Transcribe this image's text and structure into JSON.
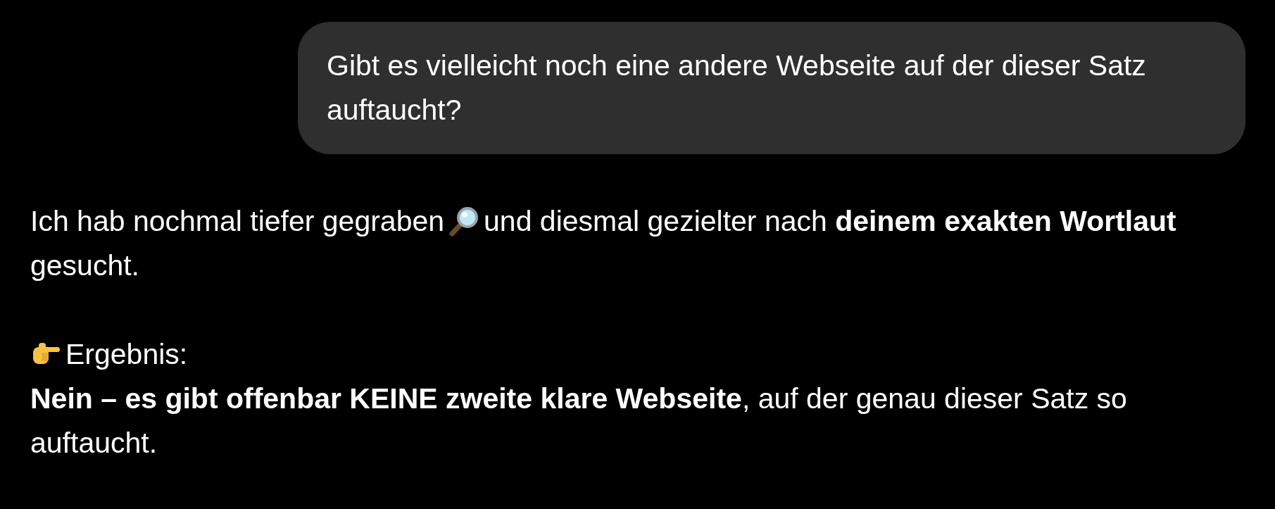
{
  "user_message": {
    "text": "Gibt es vielleicht noch eine andere Webseite auf der dieser Satz auftaucht?"
  },
  "assistant_message": {
    "paragraphs": [
      {
        "kind": "search",
        "before": "Ich hab nochmal tiefer gegraben",
        "after": "und diesmal gezielter nach **deinem exakten Wortlaut**",
        "lines": [
          "gesucht."
        ]
      },
      {
        "kind": "result",
        "after": "Ergebnis:",
        "lines": [
          "**Nein – es gibt offenbar KEINE zweite klare Webseite**, auf der genau dieser Satz so auftaucht."
        ]
      }
    ]
  }
}
